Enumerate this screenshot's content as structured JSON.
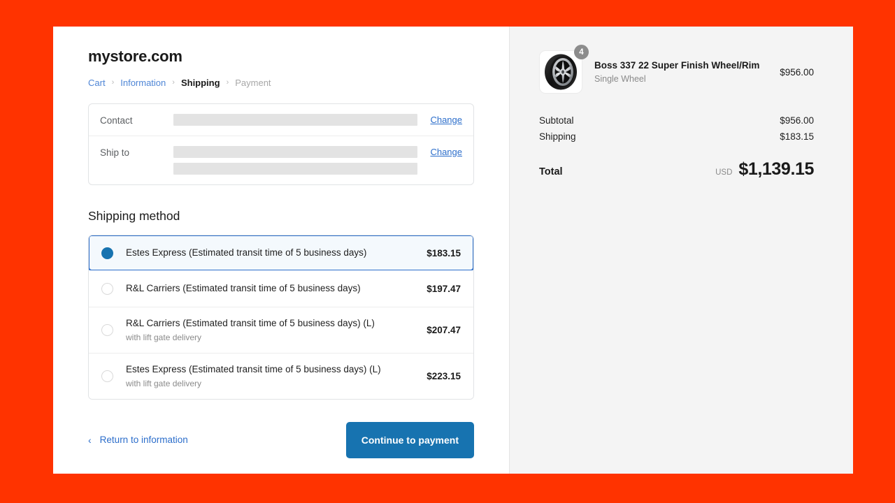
{
  "theme": {
    "page_background": "#ff3300",
    "panel_background": "#ffffff",
    "summary_background": "#f4f4f4",
    "accent_blue": "#1773b0",
    "link_blue": "#2c6ecb",
    "selected_row_background": "#f4f9fd",
    "muted_text": "#8a8a8a",
    "redaction_gray": "#e3e3e3"
  },
  "store": {
    "name": "mystore.com"
  },
  "breadcrumb": {
    "separator": "›",
    "items": [
      {
        "label": "Cart",
        "state": "link"
      },
      {
        "label": "Information",
        "state": "link"
      },
      {
        "label": "Shipping",
        "state": "active"
      },
      {
        "label": "Payment",
        "state": "muted"
      }
    ]
  },
  "review": {
    "rows": [
      {
        "label": "Contact",
        "value": "",
        "value_redacted": true,
        "redaction_bars": 1,
        "action_label": "Change"
      },
      {
        "label": "Ship to",
        "value": "",
        "value_redacted": true,
        "redaction_bars": 2,
        "action_label": "Change"
      }
    ]
  },
  "shipping": {
    "heading": "Shipping method",
    "selected_index": 0,
    "options": [
      {
        "label": "Estes Express (Estimated transit time of 5 business days)",
        "sublabel": "",
        "price": "$183.15",
        "selected": true
      },
      {
        "label": "R&L Carriers (Estimated transit time of 5 business days)",
        "sublabel": "",
        "price": "$197.47",
        "selected": false
      },
      {
        "label": "R&L Carriers (Estimated transit time of 5 business days) (L)",
        "sublabel": "with lift gate delivery",
        "price": "$207.47",
        "selected": false
      },
      {
        "label": "Estes Express (Estimated transit time of 5 business days) (L)",
        "sublabel": "with lift gate delivery",
        "price": "$223.15",
        "selected": false
      }
    ]
  },
  "footer": {
    "return_chevron": "‹",
    "return_label": "Return to information",
    "continue_label": "Continue to payment"
  },
  "summary": {
    "line_item": {
      "title": "Boss 337 22 Super Finish Wheel/Rim",
      "variant": "Single Wheel",
      "price": "$956.00",
      "quantity_badge": "4",
      "thumbnail_icon": "alloy-wheel-image"
    },
    "totals": [
      {
        "label": "Subtotal",
        "value": "$956.00"
      },
      {
        "label": "Shipping",
        "value": "$183.15"
      }
    ],
    "grand_total": {
      "label": "Total",
      "currency": "USD",
      "value": "$1,139.15"
    }
  }
}
